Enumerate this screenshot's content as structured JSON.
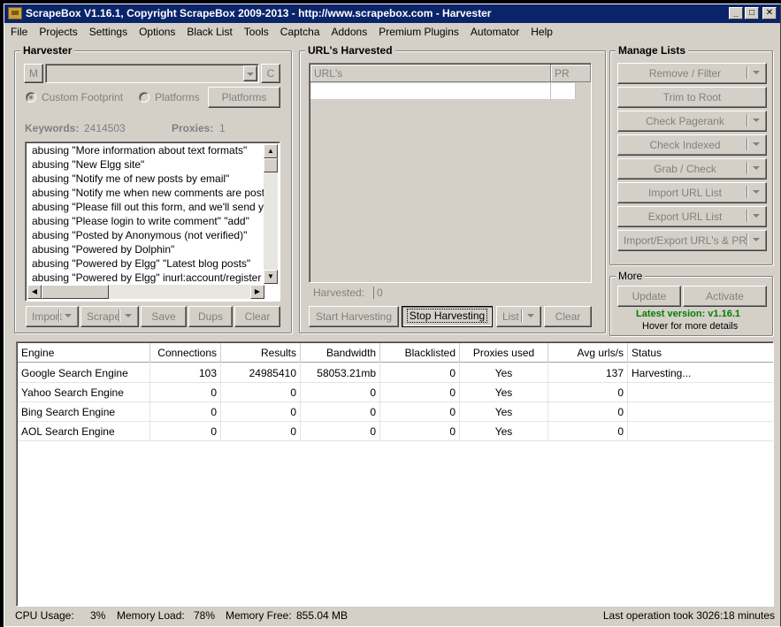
{
  "window": {
    "title": "ScrapeBox V1.16.1, Copyright ScrapeBox 2009-2013 - http://www.scrapebox.com - Harvester",
    "min_label": "_",
    "max_label": "□",
    "close_label": "✕"
  },
  "menu": [
    "File",
    "Projects",
    "Settings",
    "Options",
    "Black List",
    "Tools",
    "Captcha",
    "Addons",
    "Premium Plugins",
    "Automator",
    "Help"
  ],
  "harvester": {
    "title": "Harvester",
    "m_label": "M",
    "c_label": "C",
    "custom_footprint_label": "Custom Footprint",
    "platforms_radio_label": "Platforms",
    "platforms_button": "Platforms",
    "keywords_label": "Keywords:",
    "keywords_count": "2414503",
    "proxies_label": "Proxies:",
    "proxies_count": "1",
    "keywords": [
      "abusing \"More information about text formats\"",
      "abusing \"New Elgg site\"",
      "abusing \"Notify me of new posts by email\"",
      "abusing \"Notify me when new comments are posted\"",
      "abusing \"Please fill out this form, and we'll send you\"",
      "abusing \"Please login to write comment\" \"add\"",
      "abusing \"Posted by Anonymous (not verified)\"",
      "abusing \"Powered by Dolphin\"",
      "abusing \"Powered by Elgg\" \"Latest blog posts\"",
      "abusing \"Powered by Elgg\" inurl:account/register"
    ],
    "buttons": {
      "import": "Import",
      "scrape": "Scrape",
      "save": "Save",
      "dups": "Dups",
      "clear": "Clear"
    }
  },
  "urls": {
    "title": "URL's Harvested",
    "col_urls": "URL's",
    "col_pr": "PR",
    "harvested_label": "Harvested:",
    "harvested_count": "0",
    "buttons": {
      "start": "Start Harvesting",
      "stop": "Stop Harvesting",
      "list": "List",
      "clear": "Clear"
    }
  },
  "manage": {
    "title": "Manage Lists",
    "items": [
      {
        "label": "Remove / Filter",
        "dropdown": true
      },
      {
        "label": "Trim to Root",
        "dropdown": false
      },
      {
        "label": "Check Pagerank",
        "dropdown": true
      },
      {
        "label": "Check Indexed",
        "dropdown": true
      },
      {
        "label": "Grab / Check",
        "dropdown": true
      },
      {
        "label": "Import URL List",
        "dropdown": true
      },
      {
        "label": "Export URL List",
        "dropdown": true
      },
      {
        "label": "Import/Export URL's & PR",
        "dropdown": true
      }
    ]
  },
  "more": {
    "title": "More",
    "update": "Update",
    "activate": "Activate",
    "latest_version": "Latest version: v1.16.1",
    "hover_hint": "Hover for more details"
  },
  "engines": {
    "columns": [
      "Engine",
      "Connections",
      "Results",
      "Bandwidth",
      "Blacklisted",
      "Proxies used",
      "Avg urls/s",
      "Status"
    ],
    "rows": [
      {
        "engine": "Google Search Engine",
        "connections": "103",
        "results": "24985410",
        "bandwidth": "58053.21mb",
        "blacklisted": "0",
        "proxies_used": "Yes",
        "avg_urls": "137",
        "status": "Harvesting..."
      },
      {
        "engine": "Yahoo Search Engine",
        "connections": "0",
        "results": "0",
        "bandwidth": "0",
        "blacklisted": "0",
        "proxies_used": "Yes",
        "avg_urls": "0",
        "status": ""
      },
      {
        "engine": "Bing Search Engine",
        "connections": "0",
        "results": "0",
        "bandwidth": "0",
        "blacklisted": "0",
        "proxies_used": "Yes",
        "avg_urls": "0",
        "status": ""
      },
      {
        "engine": "AOL Search Engine",
        "connections": "0",
        "results": "0",
        "bandwidth": "0",
        "blacklisted": "0",
        "proxies_used": "Yes",
        "avg_urls": "0",
        "status": ""
      }
    ]
  },
  "status": {
    "cpu_label": "CPU Usage:",
    "cpu_value": "3%",
    "mem_load_label": "Memory Load:",
    "mem_load_value": "78%",
    "mem_free_label": "Memory Free:",
    "mem_free_value": "855.04 MB",
    "last_op": "Last operation took 3026:18 minutes"
  }
}
